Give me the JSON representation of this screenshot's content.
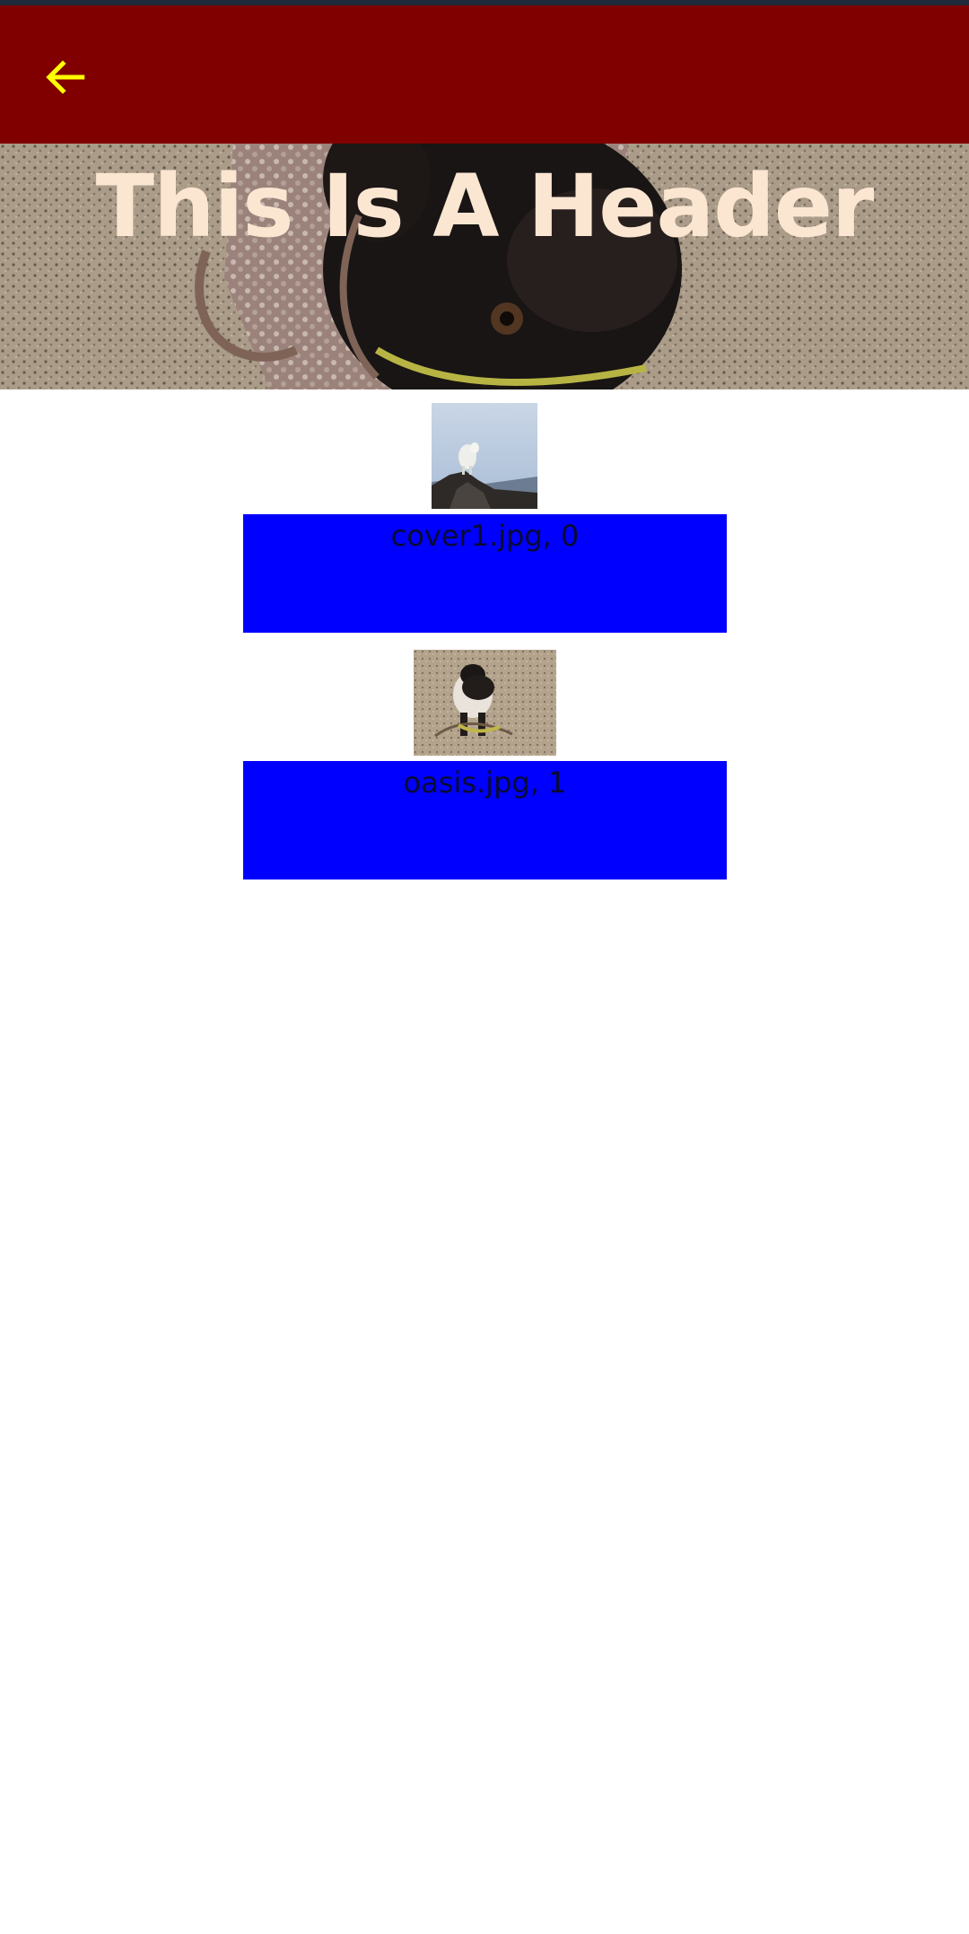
{
  "app_bar": {
    "back_icon": "arrow-left-icon",
    "color": "#800000",
    "icon_color": "#ffff00"
  },
  "hero": {
    "title": "This Is A Header",
    "title_color": "#fbe6d2",
    "image": "pug-on-carpet-photo"
  },
  "items": [
    {
      "caption": "cover1.jpg, 0",
      "image": "mountain-goat-photo"
    },
    {
      "caption": "oasis.jpg, 1",
      "image": "pug-standing-photo"
    }
  ],
  "caption_box_color": "#0000ff"
}
